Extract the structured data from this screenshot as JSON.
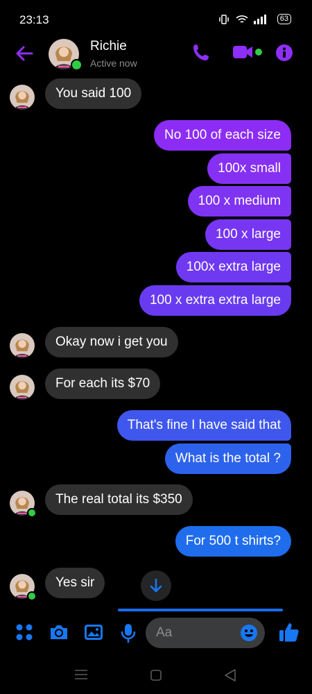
{
  "status_bar": {
    "time": "23:13",
    "battery": "63"
  },
  "header": {
    "contact_name": "Richie",
    "presence": "Active now"
  },
  "messages": [
    {
      "from": "them",
      "text": "You said 100"
    },
    {
      "from": "me",
      "text": "No 100 of each size"
    },
    {
      "from": "me",
      "text": "100x small"
    },
    {
      "from": "me",
      "text": "100 x medium"
    },
    {
      "from": "me",
      "text": "100 x large"
    },
    {
      "from": "me",
      "text": "100x extra large"
    },
    {
      "from": "me",
      "text": "100 x extra extra large"
    },
    {
      "from": "them",
      "text": "Okay now i get you"
    },
    {
      "from": "them",
      "text": "For each its $70"
    },
    {
      "from": "me",
      "text": "That's fine I have said that"
    },
    {
      "from": "me",
      "text": "What is the total ?"
    },
    {
      "from": "them",
      "text": "The real total its $350"
    },
    {
      "from": "me",
      "text": "For 500 t shirts?"
    },
    {
      "from": "them",
      "text": "Yes sir"
    }
  ],
  "composer": {
    "placeholder": "Aa"
  },
  "colors": {
    "accent_purple": "#8e2ff7",
    "accent_blue": "#1877f2",
    "online": "#31cc46",
    "incoming_bubble": "#303030"
  },
  "icons": {
    "header": [
      "back-arrow-icon",
      "phone-icon",
      "video-icon",
      "info-icon"
    ],
    "composer": [
      "apps-icon",
      "camera-icon",
      "gallery-icon",
      "mic-icon",
      "emoji-icon",
      "like-icon"
    ],
    "nav": [
      "recent-apps-icon",
      "home-icon",
      "back-icon"
    ]
  }
}
